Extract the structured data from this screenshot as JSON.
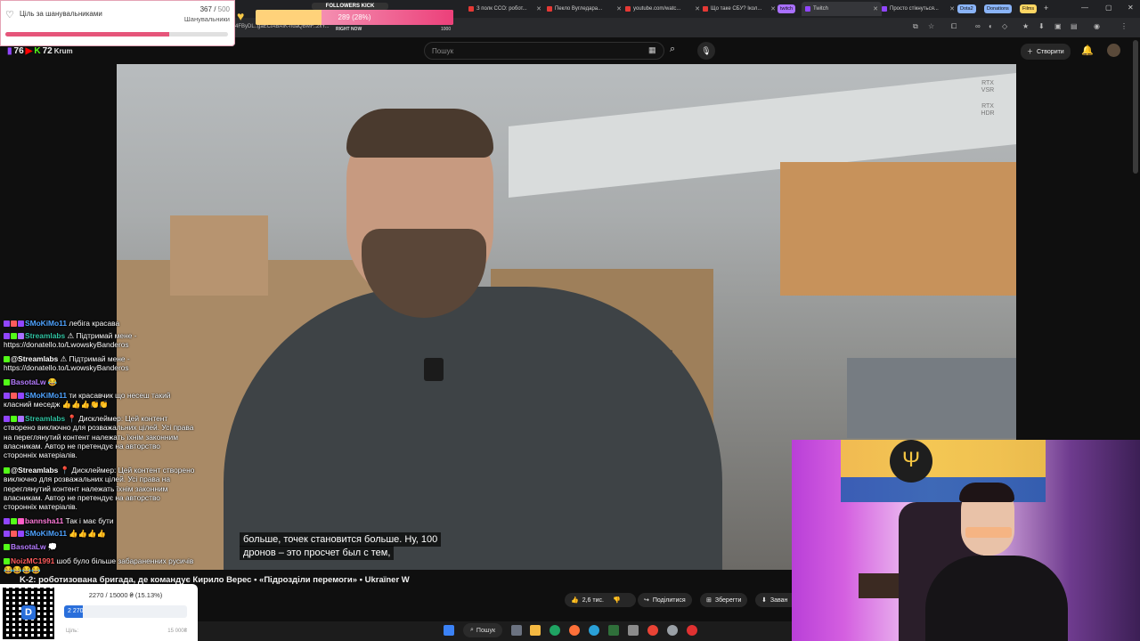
{
  "browser": {
    "tabs": [
      {
        "label": "З полк CCO: робот..."
      },
      {
        "label": "Пекло Вугледара..."
      },
      {
        "label": "youtube.com/watc..."
      },
      {
        "label": "Що таке CБУ? Ікол..."
      },
      {
        "label": "Twitch"
      },
      {
        "label": "Просто стікнуться..."
      }
    ],
    "groups": [
      {
        "label": "twitch",
        "color": "#a970ff"
      },
      {
        "label": "Dota2",
        "color": "#8ab4f8"
      },
      {
        "label": "Donations",
        "color": "#8ab4f8"
      },
      {
        "label": "Films",
        "color": "#fdd663"
      }
    ],
    "new_tab": "+",
    "url_fragment": "4FByDL..gaEClABAIK-ndaQBMF..2xY..."
  },
  "youtube": {
    "search_placeholder": "Пошук",
    "create_label": "Створити",
    "video_title": "K-2: роботизована бригада, де командує Кирило Верес • «Підрозділи перемоги» • Ukraïner W",
    "likes": "2,6 тис.",
    "share_label": "Поділитися",
    "save_label": "Зберегти",
    "download_label": "Заван",
    "subtitle_line1": "больше, точек становится больше. Ну, 100",
    "subtitle_line2": "дронов – это просчет был с тем,",
    "rtx_vsr": "RTX VSR",
    "rtx_hdr": "RTX HDR"
  },
  "stream_counts": {
    "twitch": "76",
    "kick": "72",
    "label": "Krum"
  },
  "goal_widget": {
    "title": "Ціль за шанувальниками",
    "current": "367",
    "target": "500",
    "unit": "Шанувальники",
    "progress": 0.734
  },
  "followers_widget": {
    "title": "FOLLOWERS KICK",
    "value_text": "289 (28%)",
    "progress": 0.289,
    "sub_label": "RIGHT NOW",
    "max": "1000"
  },
  "chat": [
    {
      "user": "SMoKiMo11",
      "color": "#4fa3ff",
      "text": "лебіга красава"
    },
    {
      "user": "Streamlabs",
      "color": "#31c3a2",
      "text": "⚠ Підтримай мене - https://donatello.to/LwowskyBanderos"
    },
    {
      "user": "@Streamlabs",
      "color": "#ffffff",
      "text": "⚠ Підтримай мене - https://donatello.to/LwowskyBanderos"
    },
    {
      "user": "BasotaLw",
      "color": "#b57cff",
      "text": "😂"
    },
    {
      "user": "SMoKiMo11",
      "color": "#4fa3ff",
      "text": "ти красавчик що несеш такий класний меседж 👍👍👍👏👏"
    },
    {
      "user": "Streamlabs",
      "color": "#31c3a2",
      "text": "📍 Дисклеймер: Цей контент створено виключно для розважальних цілей. Усі права на переглянутий контент належать їхнім законним власникам. Автор не претендує на авторство сторонніх матеріалів."
    },
    {
      "user": "@Streamlabs",
      "color": "#ffffff",
      "text": "📍 Дисклеймер: Цей контент створено виключно для розважальних цілей. Усі права на переглянутий контент належать їхнім законним власникам. Автор не претендує на авторство сторонніх матеріалів."
    },
    {
      "user": "bannsha11",
      "color": "#ff7ad9",
      "text": "Так і має бути"
    },
    {
      "user": "SMoKiMo11",
      "color": "#4fa3ff",
      "text": "👍👍👍👍"
    },
    {
      "user": "BasotaLw",
      "color": "#b57cff",
      "text": "💭"
    },
    {
      "user": "NoizMC1991",
      "color": "#ff5c5c",
      "text": "шоб було більше забараненних русичів 😂😂😂😂"
    }
  ],
  "donation_widget": {
    "progress_text": "2270 / 15000 ₴ (15.13%)",
    "bar_value": "2 270",
    "progress": 0.1513,
    "goal_label": "Ціль:",
    "goal_value": "15 000₴"
  },
  "taskbar": {
    "search_label": "Пошук"
  },
  "colors": {
    "accent_pink": "#f06292",
    "twitch_purple": "#9146ff",
    "kick_green": "#53fc18",
    "yt_red": "#ff0000"
  }
}
